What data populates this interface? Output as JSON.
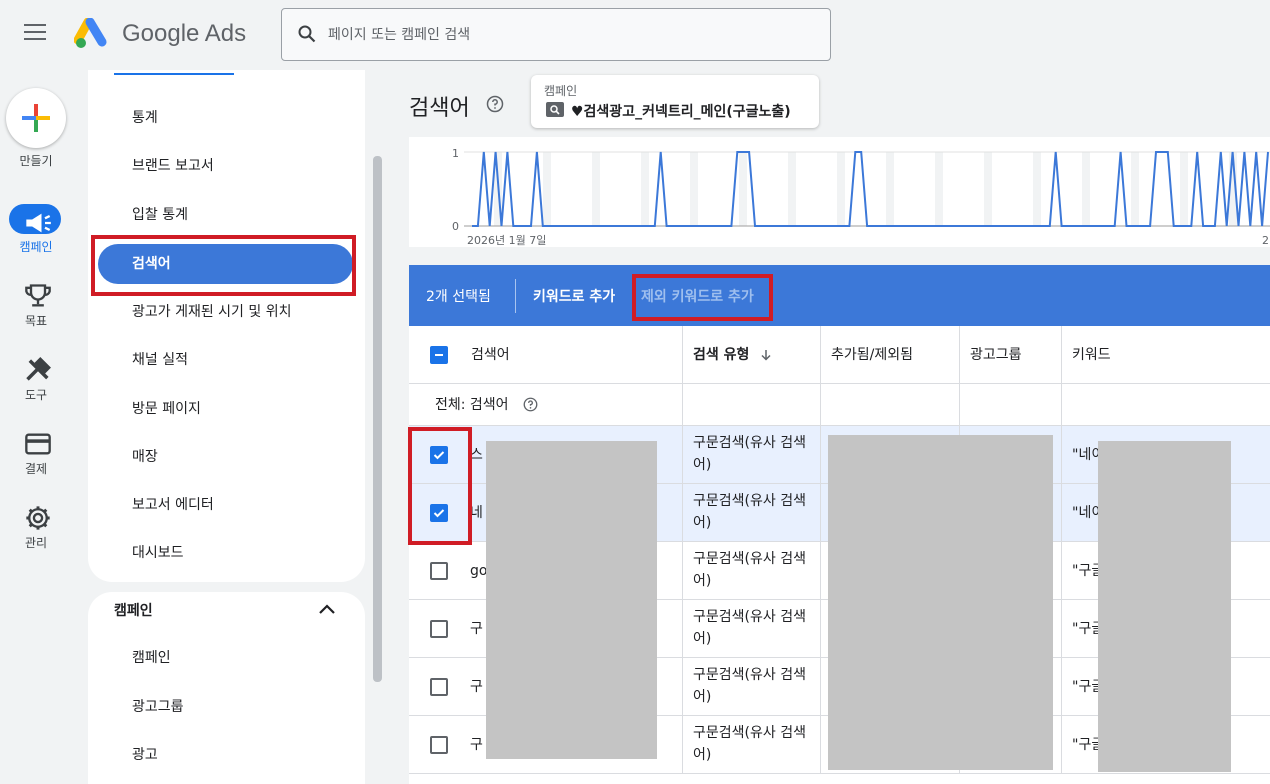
{
  "app": {
    "name": "Google Ads"
  },
  "search": {
    "placeholder": "페이지 또는 캠페인 검색"
  },
  "rail": {
    "create_label": "만들기",
    "items": [
      {
        "label": "캠페인",
        "icon": "megaphone-icon",
        "active": true
      },
      {
        "label": "목표",
        "icon": "trophy-icon"
      },
      {
        "label": "도구",
        "icon": "tools-icon"
      },
      {
        "label": "결제",
        "icon": "credit-card-icon"
      },
      {
        "label": "관리",
        "icon": "gear-icon"
      }
    ]
  },
  "sidenav": {
    "items": [
      {
        "label": "통계"
      },
      {
        "label": "브랜드 보고서"
      },
      {
        "label": "입찰 통계"
      },
      {
        "label": "검색어",
        "selected": true
      },
      {
        "label": "광고가 게재된 시기 및 위치"
      },
      {
        "label": "채널 실적"
      },
      {
        "label": "방문 페이지"
      },
      {
        "label": "매장"
      },
      {
        "label": "보고서 에디터"
      },
      {
        "label": "대시보드"
      }
    ],
    "section2": {
      "title": "캠페인",
      "items": [
        {
          "label": "캠페인"
        },
        {
          "label": "광고그룹"
        },
        {
          "label": "광고"
        }
      ]
    }
  },
  "page": {
    "title": "검색어"
  },
  "campaign_selector": {
    "label": "캠페인",
    "name": "♥검색광고_커넥트리_메인(구글노출)"
  },
  "chart_data": {
    "type": "line",
    "y_ticks": [
      "1",
      "0"
    ],
    "x_start_label": "2026년 1월 7일",
    "x_end_label": "2",
    "ylim": [
      0,
      1
    ],
    "values": [
      0,
      0,
      1,
      0,
      1,
      0,
      1,
      0,
      0,
      0,
      0,
      1,
      0,
      0,
      0,
      0,
      0,
      0,
      0,
      0,
      0,
      0,
      0,
      0,
      0,
      0,
      0,
      0,
      0,
      0,
      0,
      0,
      1,
      0,
      0,
      0,
      0,
      0,
      0,
      0,
      0,
      0,
      0,
      0,
      0,
      1,
      1,
      1,
      0,
      0,
      0,
      0,
      0,
      0,
      0,
      0,
      0,
      0,
      0,
      0,
      0,
      0,
      0,
      0,
      0,
      1,
      1,
      0,
      0,
      0,
      0,
      0,
      0,
      0,
      0,
      0,
      0,
      0,
      0,
      0,
      0,
      0,
      0,
      0,
      0,
      0,
      0,
      0,
      0,
      0,
      0,
      0,
      0,
      0,
      0,
      0,
      0,
      0,
      0,
      1,
      0,
      0,
      0,
      0,
      0,
      0,
      0,
      0,
      0,
      0,
      1,
      0,
      0,
      0,
      0,
      0,
      1,
      1,
      1,
      0,
      0,
      0,
      0,
      1,
      0,
      0,
      0,
      1,
      0,
      1,
      0,
      1,
      0,
      1,
      0,
      1
    ]
  },
  "toolbar": {
    "selected_count": "2개 선택됨",
    "add_keyword": "키워드로 추가",
    "add_negative": "제외 키워드로 추가"
  },
  "table": {
    "headers": {
      "search_term": "검색어",
      "match_type": "검색 유형",
      "added": "추가됨/제외됨",
      "ad_group": "광고그룹",
      "keyword": "키워드"
    },
    "total_label": "전체: 검색어",
    "rows": [
      {
        "checked": true,
        "term": "스",
        "match_type": "구문검색(유사 검색어)",
        "keyword": "\"네이"
      },
      {
        "checked": true,
        "term": "네",
        "match_type": "구문검색(유사 검색어)",
        "keyword": "\"네이"
      },
      {
        "checked": false,
        "term": "go",
        "match_type": "구문검색(유사 검색어)",
        "keyword": "\"구글"
      },
      {
        "checked": false,
        "term": "구",
        "match_type": "구문검색(유사 검색어)",
        "keyword": "\"구글"
      },
      {
        "checked": false,
        "term": "구",
        "match_type": "구문검색(유사 검색어)",
        "keyword": "\"구글"
      },
      {
        "checked": false,
        "term": "구",
        "match_type": "구문검색(유사 검색어)",
        "keyword": "\"구글"
      }
    ]
  },
  "colors": {
    "primary": "#1a73e8",
    "toolbar": "#3c78d8",
    "highlight": "#d01c25"
  }
}
